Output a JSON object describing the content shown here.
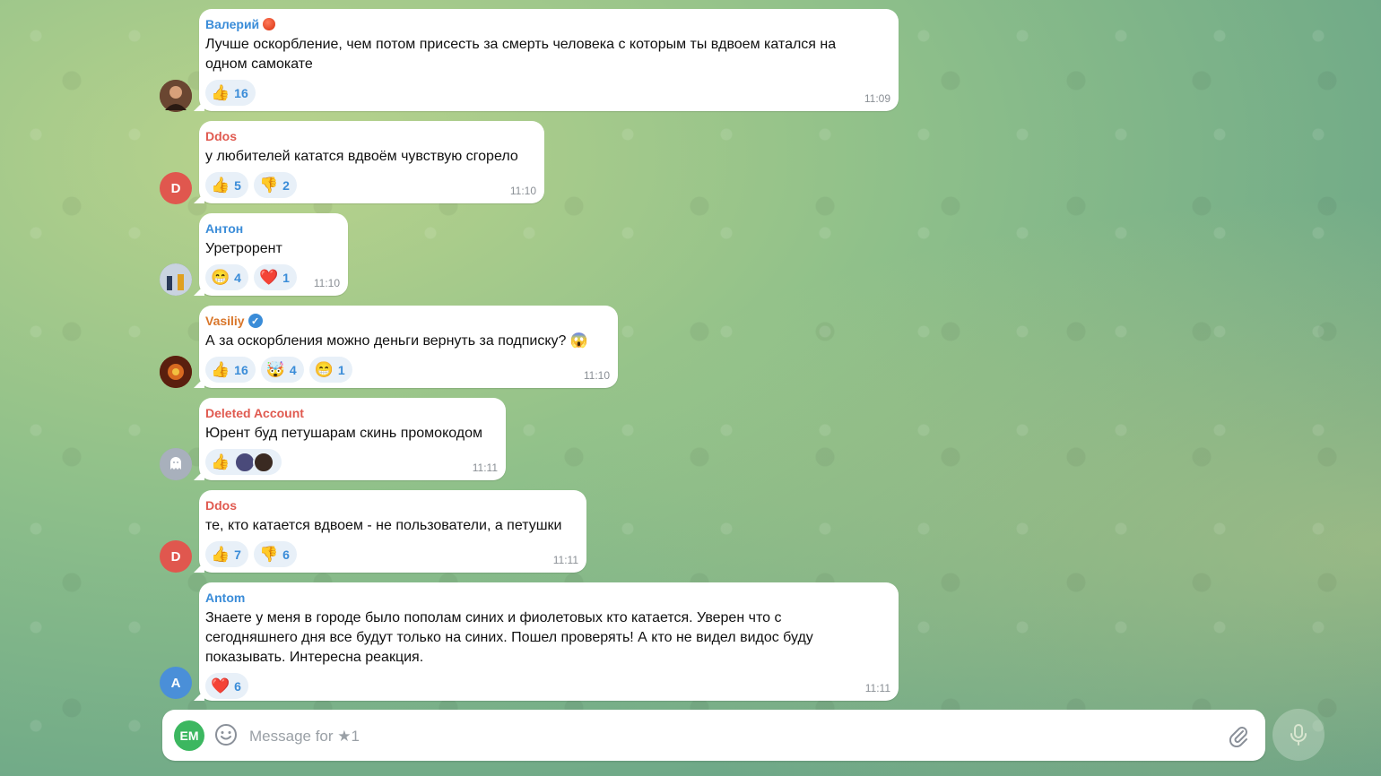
{
  "colors": {
    "accent": "#3a8cd8",
    "composer_avatar": "#3cb760"
  },
  "messages": [
    {
      "sender": "Валерий",
      "sender_color": "#3a8cd8",
      "badge": "status-dot",
      "avatar_initial": "",
      "avatar_color": "#5a3a2a",
      "text": "Лучше оскорбление, чем потом присесть за смерть человека с которым ты вдвоем катался на\nодном самокате",
      "reactions": [
        {
          "emoji": "👍",
          "count": "16"
        }
      ],
      "time": "11:09"
    },
    {
      "sender": "Ddos",
      "sender_color": "#e05a50",
      "badge": "",
      "avatar_initial": "D",
      "avatar_color": "#e0574e",
      "text": "у любителей кататся вдвоём чувствую сгорело",
      "reactions": [
        {
          "emoji": "👍",
          "count": "5"
        },
        {
          "emoji": "👎",
          "count": "2"
        }
      ],
      "time": "11:10"
    },
    {
      "sender": "Антон",
      "sender_color": "#3a8cd8",
      "badge": "",
      "avatar_initial": "",
      "avatar_color": "#6e7f9a",
      "text": "Уретрорент",
      "reactions": [
        {
          "emoji": "😁",
          "count": "4"
        },
        {
          "emoji": "❤️",
          "count": "1"
        }
      ],
      "time": "11:10"
    },
    {
      "sender": "Vasiliy",
      "sender_color": "#d9762a",
      "badge": "verified",
      "avatar_initial": "",
      "avatar_color": "#7a2a12",
      "text": "А за оскорбления можно деньги вернуть за подписку? 😱",
      "reactions": [
        {
          "emoji": "👍",
          "count": "16"
        },
        {
          "emoji": "🤯",
          "count": "4"
        },
        {
          "emoji": "😁",
          "count": "1"
        }
      ],
      "time": "11:10"
    },
    {
      "sender": "Deleted Account",
      "sender_color": "#e05a50",
      "badge": "",
      "avatar_initial": "",
      "avatar_color": "#9aa3b0",
      "text": "Юрент буд петушарам скинь промокодом",
      "reactions": [
        {
          "emoji": "👍",
          "count": "",
          "avatars": 2
        }
      ],
      "time": "11:11"
    },
    {
      "sender": "Ddos",
      "sender_color": "#e05a50",
      "badge": "",
      "avatar_initial": "D",
      "avatar_color": "#e0574e",
      "text": "те, кто катается вдвоем - не пользователи, а петушки",
      "reactions": [
        {
          "emoji": "👍",
          "count": "7"
        },
        {
          "emoji": "👎",
          "count": "6"
        }
      ],
      "time": "11:11"
    },
    {
      "sender": "Antom",
      "sender_color": "#3a8cd8",
      "badge": "",
      "avatar_initial": "A",
      "avatar_color": "#4a8fd8",
      "text": "Знаете у меня в городе было пополам синих и фиолетовых кто катается. Уверен что с\nсегодняшнего дня все будут только на синих. Пошел проверять! А кто не видел видос буду\nпоказывать. Интересна реакция.",
      "reactions": [
        {
          "emoji": "❤️",
          "count": "6"
        }
      ],
      "time": "11:11"
    }
  ],
  "composer": {
    "avatar_initials": "EM",
    "placeholder": "Message for ★1",
    "smile_icon": "smile-icon",
    "attach_icon": "paperclip-icon",
    "mic_icon": "microphone-icon"
  }
}
